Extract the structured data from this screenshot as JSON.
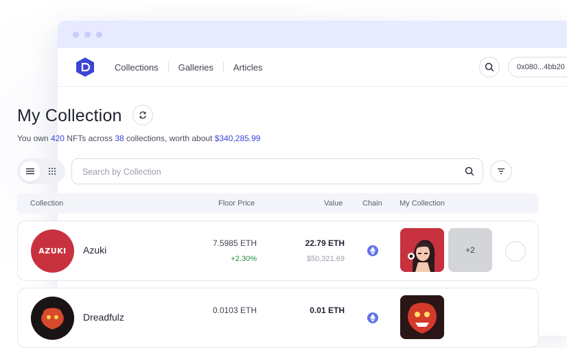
{
  "nav": {
    "links": [
      "Collections",
      "Galleries",
      "Articles"
    ],
    "wallet": "0x080...4bb20"
  },
  "header": {
    "title": "My Collection",
    "summary": {
      "prefix": "You own ",
      "nft_count": "420",
      "mid1": " NFTs across ",
      "collection_count": "38",
      "mid2": " collections, worth about ",
      "worth": "$340,285.99"
    }
  },
  "search": {
    "placeholder": "Search by Collection"
  },
  "table": {
    "columns": {
      "collection": "Collection",
      "floor_price": "Floor Price",
      "value": "Value",
      "chain": "Chain",
      "my_collection": "My Collection"
    },
    "rows": [
      {
        "name": "Azuki",
        "avatar_text": "AZUKI",
        "floor_price": "7.5985 ETH",
        "change": "+2.30%",
        "value": "22.79 ETH",
        "value_usd": "$50,321.69",
        "chain": "ethereum",
        "more": "+2"
      },
      {
        "name": "Dreadfulz",
        "floor_price": "0.0103 ETH",
        "value": "0.01 ETH",
        "chain": "ethereum"
      }
    ]
  },
  "colors": {
    "accent": "#3b45d6",
    "positive": "#1f8a3b",
    "azuki_red": "#c8323f",
    "titlebar": "#e8eaff"
  }
}
